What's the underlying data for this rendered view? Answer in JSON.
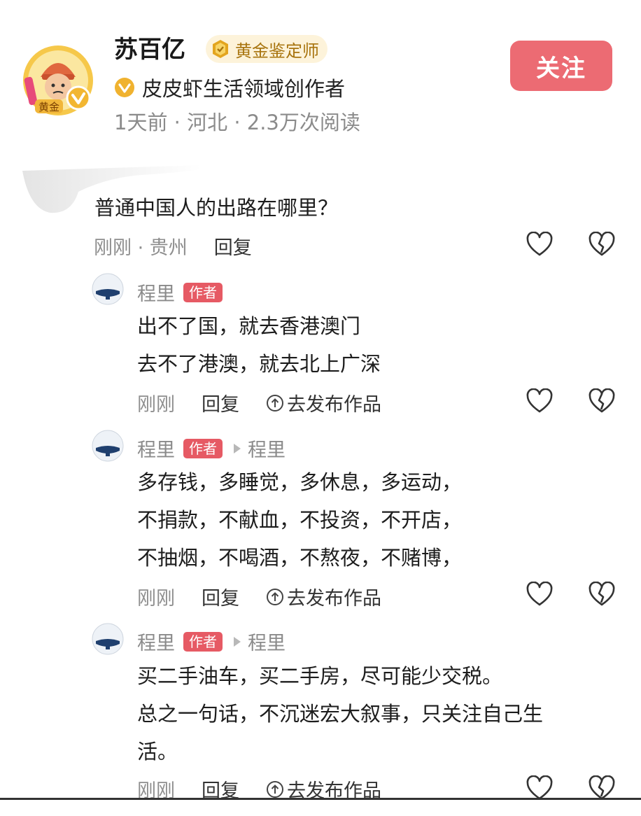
{
  "author": {
    "name": "苏百亿",
    "badge": "黄金鉴定师",
    "avatar_label": "黄金",
    "creator": "皮皮虾生活领域创作者",
    "meta": "1天前 · 河北 · 2.3万次阅读",
    "follow_label": "关注"
  },
  "root_comment": {
    "text": "普通中国人的出路在哪里？",
    "meta": "刚刚 · 贵州",
    "reply_label": "回复"
  },
  "replies": [
    {
      "user": "程里",
      "tag": "作者",
      "reply_to": "",
      "lines": [
        "出不了国，就去香港澳门",
        "去不了港澳，就去北上广深"
      ],
      "time": "刚刚",
      "reply_label": "回复",
      "publish_label": "去发布作品"
    },
    {
      "user": "程里",
      "tag": "作者",
      "reply_to": "程里",
      "lines": [
        "多存钱，多睡觉，多休息，多运动，",
        "不捐款，不献血，不投资，不开店，",
        "不抽烟，不喝酒，不熬夜，不赌博，"
      ],
      "time": "刚刚",
      "reply_label": "回复",
      "publish_label": "去发布作品"
    },
    {
      "user": "程里",
      "tag": "作者",
      "reply_to": "程里",
      "lines": [
        "买二手油车，买二手房，尽可能少交税。",
        "总之一句话，不沉迷宏大叙事，只关注自己生",
        "活。"
      ],
      "time": "刚刚",
      "reply_label": "回复",
      "publish_label": "去发布作品"
    }
  ],
  "colors": {
    "follow_button": "#ec6b73",
    "author_tag": "#e65a64",
    "gold_badge_bg": "#fdf3da",
    "gold_text": "#a8740e"
  }
}
